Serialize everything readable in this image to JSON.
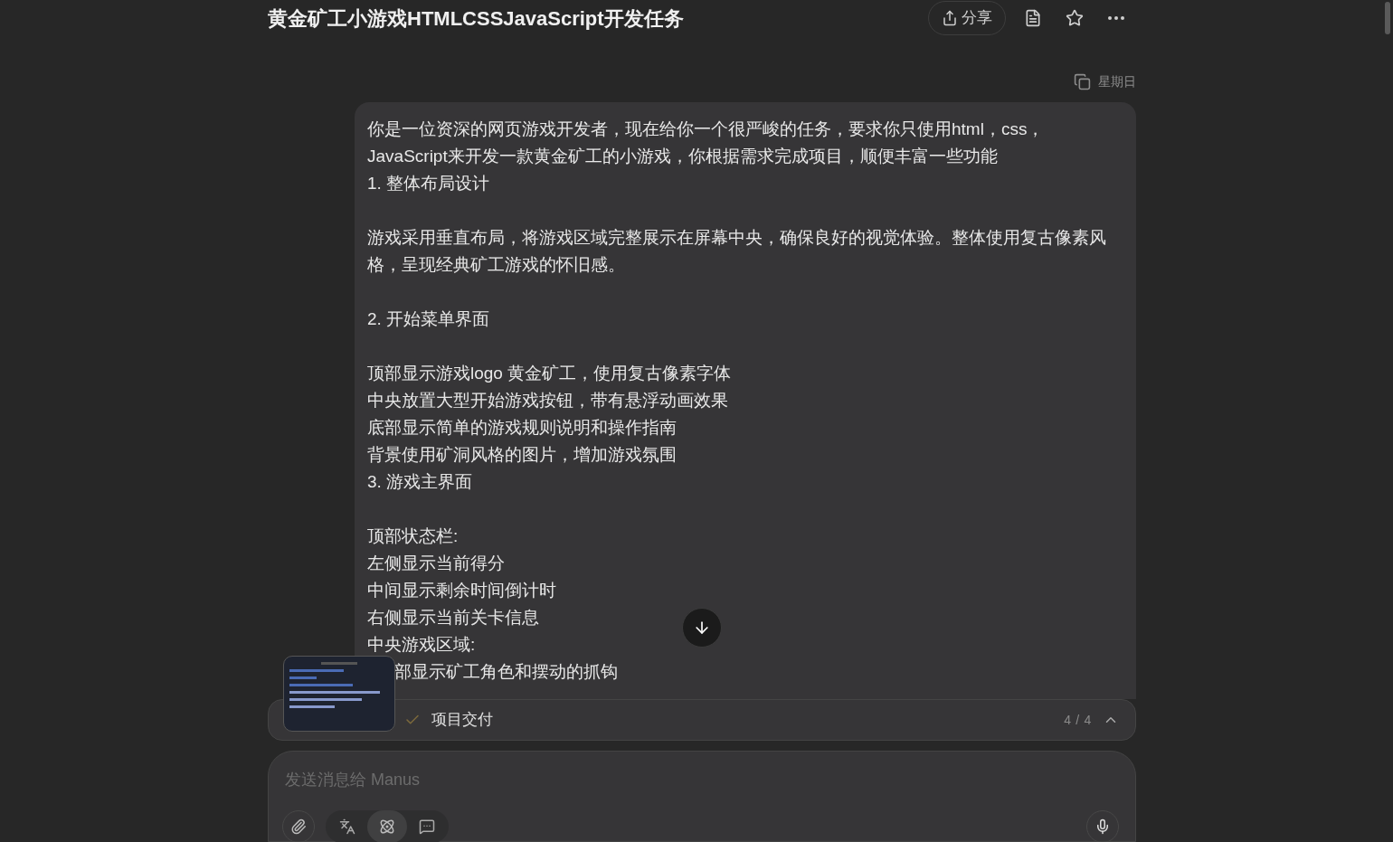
{
  "header": {
    "title": "黄金矿工小游戏HTMLCSSJavaScript开发任务",
    "share_label": "分享"
  },
  "message": {
    "time": "星期日",
    "blocks": [
      [
        "你是一位资深的网页游戏开发者，现在给你一个很严峻的任务，要求你只使用html，css，JavaScript来开发一款黄金矿工的小游戏，你根据需求完成项目，顺便丰富一些功能",
        "1. 整体布局设计"
      ],
      [
        "游戏采用垂直布局，将游戏区域完整展示在屏幕中央，确保良好的视觉体验。整体使用复古像素风格，呈现经典矿工游戏的怀旧感。"
      ],
      [
        "2. 开始菜单界面"
      ],
      [
        "顶部显示游戏logo 黄金矿工，使用复古像素字体",
        "中央放置大型开始游戏按钮，带有悬浮动画效果",
        "底部显示简单的游戏规则说明和操作指南",
        "背景使用矿洞风格的图片，增加游戏氛围",
        "3. 游戏主界面"
      ],
      [
        "顶部状态栏:",
        "左侧显示当前得分",
        "中间显示剩余时间倒计时",
        "右侧显示当前关卡信息",
        "中央游戏区域:"
      ]
    ],
    "covered_line": "部显示矿工角色和摆动的抓钩"
  },
  "progress": {
    "step": "项目交付",
    "done": true,
    "count": "4 / 4"
  },
  "composer": {
    "placeholder": "发送消息给 Manus"
  }
}
